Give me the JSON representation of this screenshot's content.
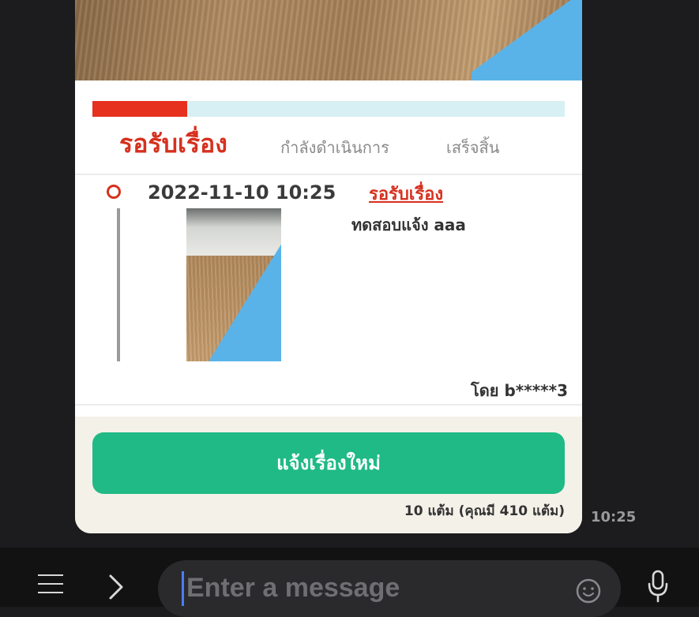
{
  "tracker": {
    "progress_fraction": 0.2,
    "steps": {
      "pending": "รอรับเรื่อง",
      "in_progress": "กำลังดำเนินการ",
      "done": "เสร็จสิ้น"
    }
  },
  "timeline": {
    "entry": {
      "datetime": "2022-11-10 10:25",
      "status": "รอรับเรื่อง",
      "message": "ทดสอบแจ้ง aaa",
      "author": "โดย b*****3"
    }
  },
  "footer": {
    "new_report_button": "แจ้งเรื่องใหม่",
    "points_text": "10 แต้ม (คุณมี 410 แต้ม)"
  },
  "chat": {
    "timestamp": "10:25",
    "input_placeholder": "Enter a message"
  },
  "colors": {
    "accent_red": "#d7301e",
    "cta_green": "#20ba86",
    "progress_track": "#d7f0f4"
  },
  "icons": {
    "menu": "menu-icon",
    "chevron": "chevron-right-icon",
    "emoji": "emoji-icon",
    "mic": "microphone-icon"
  }
}
